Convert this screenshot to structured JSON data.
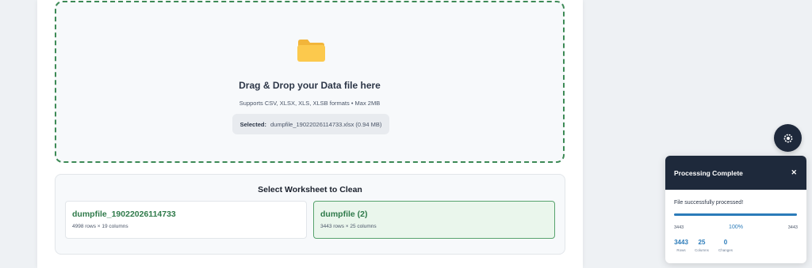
{
  "upload": {
    "folder_icon": "folder-icon",
    "title": "Drag & Drop your Data file here",
    "subtitle": "Supports CSV, XLSX, XLS, XLSB formats • Max 2MB",
    "selected_label": "Selected:",
    "selected_file": "dumpfile_19022026114733.xlsx (0.94 MB)",
    "border_color": "#3d8a56"
  },
  "worksheets": {
    "title": "Select Worksheet to Clean",
    "items": [
      {
        "name": "dumpfile_19022026114733",
        "meta": "4998 rows × 19 columns",
        "selected": false
      },
      {
        "name": "dumpfile (2)",
        "meta": "3443 rows × 25 columns",
        "selected": true
      }
    ]
  },
  "fab": {
    "icon": "settings-gear-icon"
  },
  "toast": {
    "title": "Processing Complete",
    "close_icon": "close-icon",
    "message": "File successfully processed!",
    "progress": {
      "fraction": 1.0,
      "left": "3443",
      "percent": "100%",
      "right": "3443"
    },
    "stats": [
      {
        "value": "3443",
        "caption": "Rows"
      },
      {
        "value": "25",
        "caption": "Columns"
      },
      {
        "value": "0",
        "caption": "Changes"
      }
    ]
  },
  "colors": {
    "accent_green": "#2f7a4a",
    "accent_blue": "#2b7bb9",
    "dark": "#1e293b"
  }
}
